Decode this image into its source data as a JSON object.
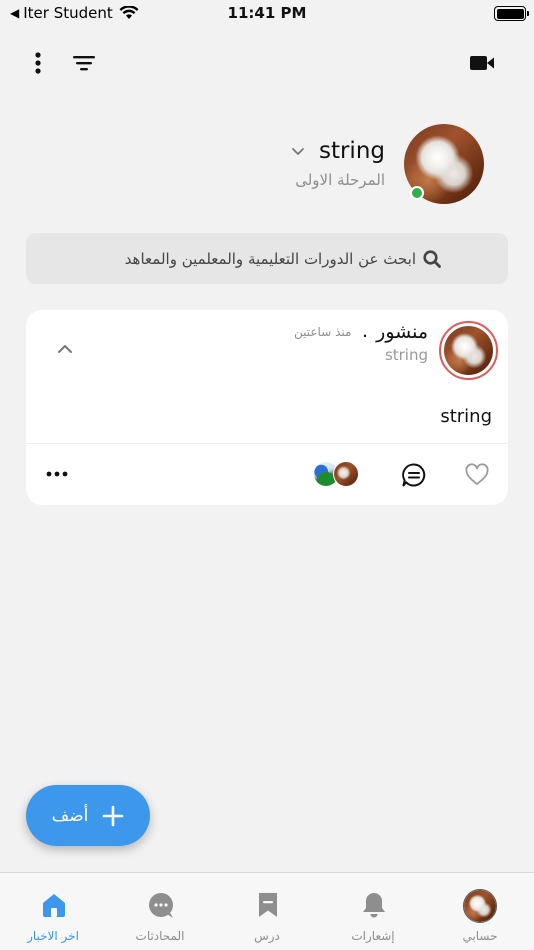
{
  "status_bar": {
    "back_app": "Iter Student",
    "time": "11:41 PM",
    "battery_level": 1.0
  },
  "toolbar": {
    "icons": [
      "more-vertical-icon",
      "filter-icon",
      "video-camera-icon"
    ]
  },
  "profile": {
    "name": "string",
    "stage": "المرحلة الاولى",
    "online": true,
    "online_color": "#2fb14a"
  },
  "search": {
    "placeholder": "ابحث عن الدورات التعليمية والمعلمين والمعاهد"
  },
  "post": {
    "title": "منشور",
    "separator": ".",
    "time": "منذ ساعتين",
    "author": "string",
    "body": "string",
    "avatar_ring_color": "#e05a5a"
  },
  "fab": {
    "label": "أضف"
  },
  "tabs": [
    {
      "label": "حسابي",
      "icon": "avatar",
      "active": false
    },
    {
      "label": "إشعارات",
      "icon": "bell-icon",
      "active": false
    },
    {
      "label": "درس",
      "icon": "bookmark-icon",
      "active": false
    },
    {
      "label": "المحادثات",
      "icon": "chat-bubble-icon",
      "active": false
    },
    {
      "label": "اخر الاخبار",
      "icon": "home-icon",
      "active": true
    }
  ],
  "colors": {
    "accent": "#3d97ea",
    "background": "#f2f2f2",
    "card": "#ffffff",
    "muted_text": "#8e8e8e"
  }
}
